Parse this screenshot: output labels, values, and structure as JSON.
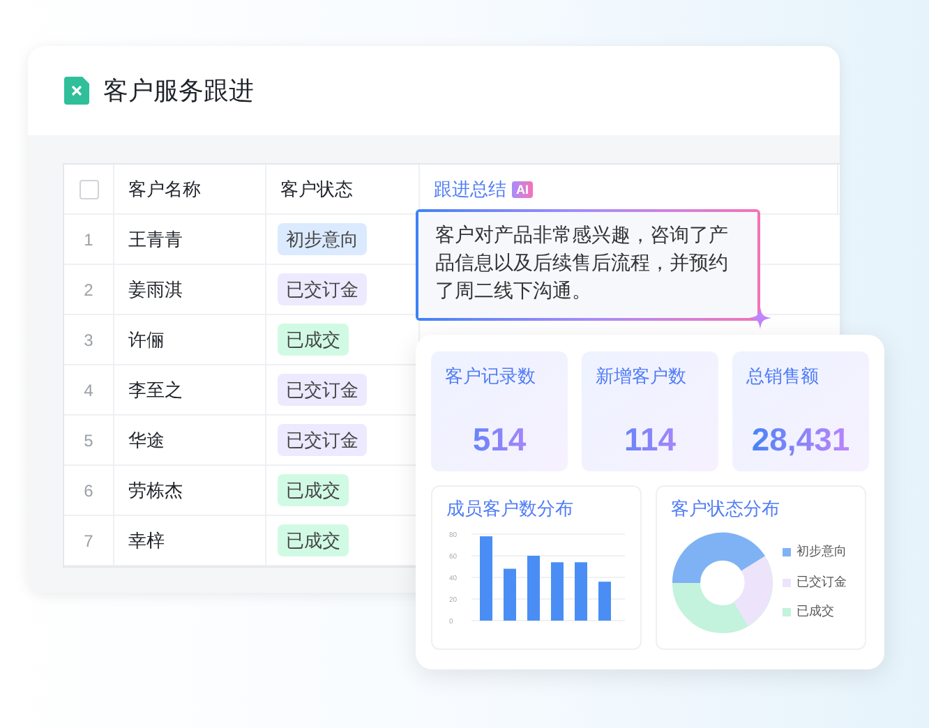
{
  "app": {
    "title": "客户服务跟进"
  },
  "table": {
    "select_all": {
      "checked": false
    },
    "columns": [
      "客户名称",
      "客户状态",
      "跟进总结"
    ],
    "ai_badge": "AI",
    "rows": [
      {
        "index": "1",
        "name": "王青青",
        "status": "初步意向",
        "color": "#dbeafe"
      },
      {
        "index": "2",
        "name": "姜雨淇",
        "status": "已交订金",
        "color": "#ede9fe"
      },
      {
        "index": "3",
        "name": "许俪",
        "status": "已成交",
        "color": "#d1fae5"
      },
      {
        "index": "4",
        "name": "李至之",
        "status": "已交订金",
        "color": "#ede9fe"
      },
      {
        "index": "5",
        "name": "华途",
        "status": "已交订金",
        "color": "#ede9fe"
      },
      {
        "index": "6",
        "name": "劳栋杰",
        "status": "已成交",
        "color": "#d1fae5"
      },
      {
        "index": "7",
        "name": "幸梓",
        "status": "已成交",
        "color": "#d1fae5"
      }
    ],
    "summary": "客户对产品非常感兴趣，咨询了产品信息以及后续售后流程，并预约了周二线下沟通。"
  },
  "dashboard": {
    "stats": [
      {
        "label": "客户记录数",
        "value": "514"
      },
      {
        "label": "新增客户数",
        "value": "114"
      },
      {
        "label": "总销售额",
        "value": "28,431"
      }
    ],
    "bar_panel": {
      "title": "成员客户数分布",
      "chart_data": {
        "type": "bar",
        "values": [
          78,
          48,
          60,
          54,
          54,
          36
        ],
        "ylim": [
          0,
          80
        ],
        "grid": true,
        "yticks": [
          0,
          20,
          40,
          60,
          80
        ]
      }
    },
    "donut_panel": {
      "title": "客户状态分布",
      "legend": [
        {
          "label": "初步意向",
          "color": "#7fb2f5"
        },
        {
          "label": "已交订金",
          "color": "#ede4fb"
        },
        {
          "label": "已成交",
          "color": "#c3f2dd"
        }
      ]
    }
  }
}
